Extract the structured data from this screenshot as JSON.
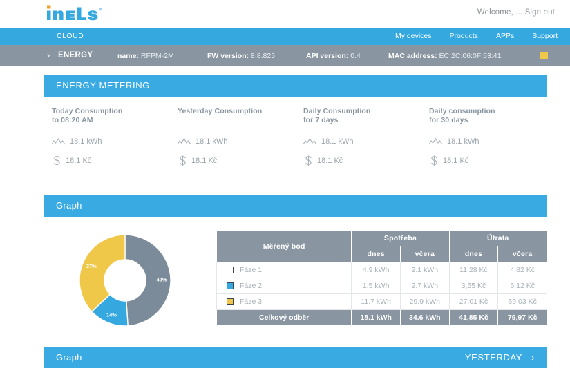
{
  "brand": {
    "logo_text": "iNELS",
    "logo_icon": "inels-logo",
    "accent_blue": "#35a8e0",
    "accent_orange": "#f0a02a",
    "gray": "#8995a1",
    "yellow": "#f0c849"
  },
  "header": {
    "welcome_text": "Welcome, ...",
    "signout_label": "Sign out"
  },
  "nav": {
    "cloud_label": "CLOUD",
    "links": [
      {
        "label": "My devices"
      },
      {
        "label": "Products"
      },
      {
        "label": "APPs"
      },
      {
        "label": "Support"
      }
    ]
  },
  "device": {
    "expand_icon": "chevron-right-icon",
    "section_label": "ENERGY",
    "fields": [
      {
        "key": "name:",
        "value": "RFPM-2M"
      },
      {
        "key": "FW version:",
        "value": "8.8.825"
      },
      {
        "key": "API version:",
        "value": "0.4"
      },
      {
        "key": "MAC address:",
        "value": "EC:2C:06:0F:53:41"
      }
    ],
    "status_swatch_color": "#f0c849"
  },
  "metering": {
    "section_title": "ENERGY METERING",
    "cards": [
      {
        "title_line1": "Today Consumption",
        "title_line2": "to 08:20 AM",
        "energy_icon": "zigzag-chart-icon",
        "energy_value": "18.1 kWh",
        "cost_icon": "currency-dollar-icon",
        "cost_value": "18.1 Kč"
      },
      {
        "title_line1": "Yesterday Consumption",
        "title_line2": "",
        "energy_icon": "zigzag-chart-icon",
        "energy_value": "18.1 kWh",
        "cost_icon": "currency-dollar-icon",
        "cost_value": "18.1 Kč"
      },
      {
        "title_line1": "Daily Consumption",
        "title_line2": "for 7 days",
        "energy_icon": "zigzag-chart-icon",
        "energy_value": "18.1 kWh",
        "cost_icon": "currency-dollar-icon",
        "cost_value": "18.1 Kč"
      },
      {
        "title_line1": "Daily consumption",
        "title_line2": "for 30 days",
        "energy_icon": "zigzag-chart-icon",
        "energy_value": "18.1 kWh",
        "cost_icon": "currency-dollar-icon",
        "cost_value": "18.1 Kč"
      }
    ]
  },
  "graph_top": {
    "section_title": "Graph"
  },
  "graph_bottom": {
    "section_title": "Graph",
    "right_label": "YESTERDAY",
    "right_icon": "chevron-right-icon"
  },
  "chart_data": {
    "type": "pie",
    "title": "",
    "variant": "donut",
    "labels": [
      "Fáze 1",
      "Fáze 2",
      "Fáze 3"
    ],
    "values": [
      49,
      14,
      37
    ],
    "value_unit": "%",
    "data_labels": [
      "49%",
      "14%",
      "37%"
    ],
    "colors": [
      "#7b8b9a",
      "#35a8e0",
      "#f0c849"
    ],
    "start_angle_deg": 0,
    "legend": "none",
    "grid": false
  },
  "table": {
    "group_headers": [
      {
        "label": "Měřený bod",
        "span": 1,
        "rows": 2
      },
      {
        "label": "Spotřeba",
        "span": 2
      },
      {
        "label": "Útrata",
        "span": 2
      }
    ],
    "sub_headers": [
      "dnes",
      "včera",
      "dnes",
      "včera"
    ],
    "rows": [
      {
        "swatch_color": "#ffffff",
        "label": "Fáze 1",
        "cells": [
          "4.9 kWh",
          "2.1 kWh",
          "11,28 Kč",
          "4,82 Kč"
        ]
      },
      {
        "swatch_color": "#35a8e0",
        "label": "Fáze 2",
        "cells": [
          "1.5 kWh",
          "2.7 kWh",
          "3,55 Kč",
          "6,12 Kč"
        ]
      },
      {
        "swatch_color": "#f0c849",
        "label": "Fáze 3",
        "cells": [
          "11.7 kWh",
          "29.9 kWh",
          "27.01 Kč",
          "69.03 Kč"
        ]
      }
    ],
    "total_row": {
      "label": "Celkový odběr",
      "cells": [
        "18.1 kWh",
        "34.6 kWh",
        "41,85 Kč",
        "79,97 Kč"
      ]
    }
  }
}
